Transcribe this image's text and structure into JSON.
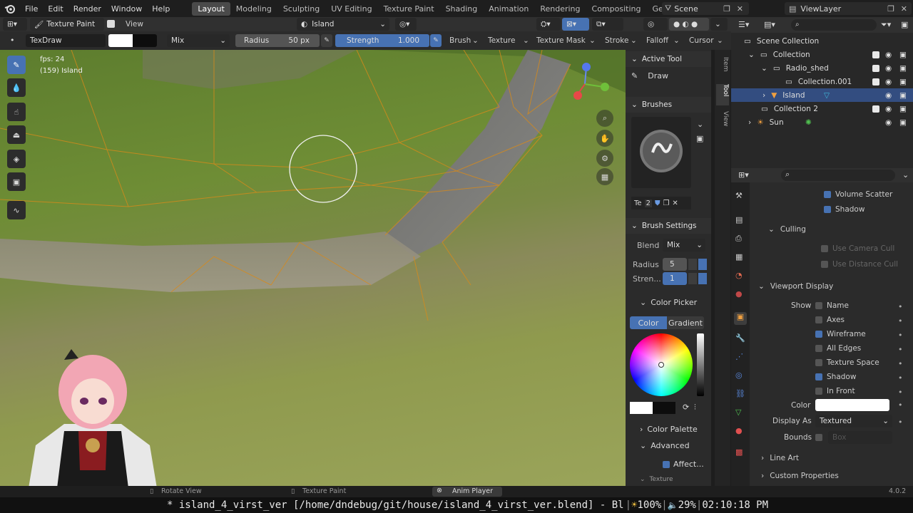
{
  "topbar": {
    "menus": [
      "File",
      "Edit",
      "Render",
      "Window",
      "Help"
    ],
    "workspaces": [
      "Layout",
      "Modeling",
      "Sculpting",
      "UV Editing",
      "Texture Paint",
      "Shading",
      "Animation",
      "Rendering",
      "Compositing",
      "Geometry"
    ],
    "active_workspace": "Layout",
    "scene": "Scene",
    "view_layer": "ViewLayer"
  },
  "header2": {
    "mode": "Texture Paint",
    "view": "View",
    "object": "Island"
  },
  "tool_settings": {
    "brush_name": "TexDraw",
    "blend": "Mix",
    "radius_label": "Radius",
    "radius_value": "50 px",
    "strength_label": "Strength",
    "strength_value": "1.000",
    "brush": "Brush",
    "texture": "Texture",
    "texture_mask": "Texture Mask",
    "stroke": "Stroke",
    "falloff": "Falloff",
    "cursor": "Cursor"
  },
  "viewport": {
    "fps": "fps: 24",
    "object_info": "(159) Island"
  },
  "npanel": {
    "active_tool_title": "Active Tool",
    "tool_name": "Draw",
    "brushes_title": "Brushes",
    "brush_short": "Te",
    "brush_users": "2",
    "brush_settings_title": "Brush Settings",
    "blend_label": "Blend",
    "blend_value": "Mix",
    "radius_label": "Radius",
    "radius_value": "5",
    "strength_label": "Stren...",
    "strength_value": "1",
    "color_picker_title": "Color Picker",
    "color_tab": "Color",
    "gradient_tab": "Gradient",
    "color_palette": "Color Palette",
    "advanced": "Advanced",
    "affect": "Affect...",
    "texture": "Texture"
  },
  "vtabs": [
    "Item",
    "Tool",
    "View"
  ],
  "outliner": {
    "title": "Scene Collection",
    "rows": [
      {
        "label": "Collection"
      },
      {
        "label": "Radio_shed"
      },
      {
        "label": "Collection.001"
      },
      {
        "label": "Island"
      },
      {
        "label": "Collection 2"
      },
      {
        "label": "Sun"
      }
    ]
  },
  "props": {
    "volume_scatter": "Volume Scatter",
    "shadow": "Shadow",
    "culling": "Culling",
    "use_camera_cull": "Use Camera Cull",
    "use_distance_cull": "Use Distance Cull",
    "viewport_display": "Viewport Display",
    "show": "Show",
    "name": "Name",
    "axes": "Axes",
    "wireframe": "Wireframe",
    "all_edges": "All Edges",
    "texture_space": "Texture Space",
    "shadow2": "Shadow",
    "in_front": "In Front",
    "color": "Color",
    "display_as": "Display As",
    "display_as_value": "Textured",
    "bounds": "Bounds",
    "bounds_value": "Box",
    "line_art": "Line Art",
    "custom_properties": "Custom Properties"
  },
  "statusbar": {
    "rotate_view": "Rotate View",
    "texture_paint": "Texture Paint",
    "anim_player": "Anim Player",
    "version": "4.0.2"
  },
  "terminal": {
    "text": "* island_4_virst_ver [/home/dndebug/git/house/island_4_virst_ver.blend] - Bl",
    "battery": "100%",
    "volume": "29%",
    "clock": "02:10:18 PM"
  }
}
